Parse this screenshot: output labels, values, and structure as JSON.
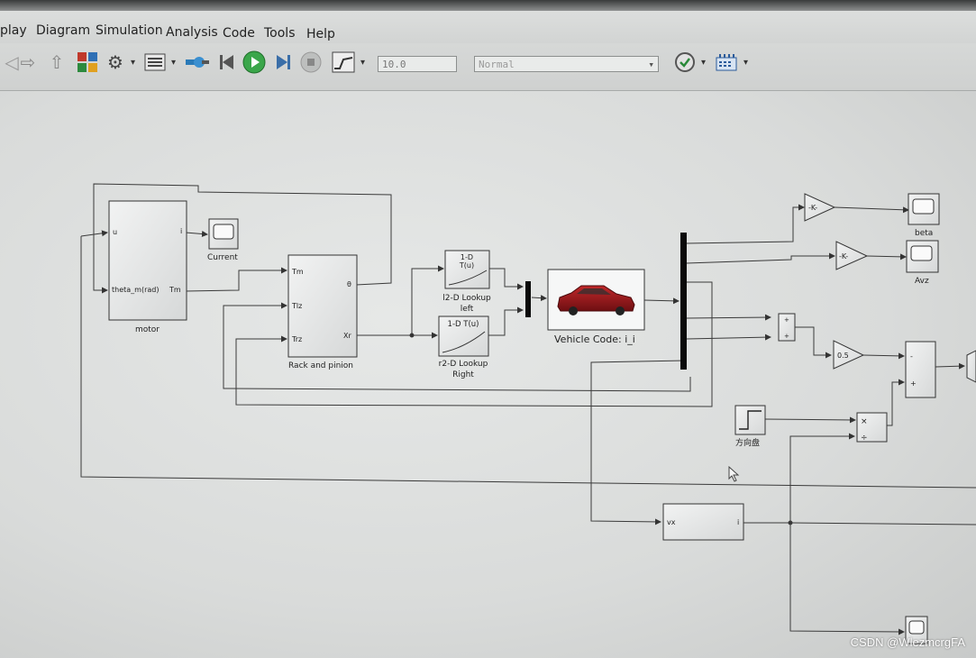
{
  "menu": {
    "items": [
      {
        "label": "play"
      },
      {
        "label": "Diagram"
      },
      {
        "label": "Simulation"
      },
      {
        "label": "Analysis"
      },
      {
        "label": "Code"
      },
      {
        "label": "Tools"
      },
      {
        "label": "Help"
      }
    ]
  },
  "toolbar": {
    "stop_time": "10.0",
    "mode": "Normal",
    "icons": [
      "forward-icon",
      "up-icon",
      "library-browser-icon",
      "settings-gear-icon",
      "model-explorer-icon",
      "connect-icon",
      "step-back-icon",
      "run-icon",
      "step-forward-icon",
      "stop-icon",
      "scope-icon",
      "check-icon",
      "build-icon"
    ]
  },
  "blocks": {
    "motor": {
      "in_u": "u",
      "in_theta": "theta_m(rad)",
      "out_i": "i",
      "out_tm": "Tm",
      "name": "motor"
    },
    "current_scope": {
      "name": "Current"
    },
    "rack": {
      "in_tm": "Tm",
      "in_tlz": "Tlz",
      "in_trz": "Trz",
      "out_theta": "θ",
      "out_xr": "Xr",
      "name": "Rack and pinion"
    },
    "lookup_left": {
      "header1": "1-D",
      "header2": "T(u)",
      "name1": "l2-D Lookup",
      "name2": "left"
    },
    "lookup_right": {
      "header": "1-D T(u)",
      "name1": "r2-D Lookup",
      "name2": "Right"
    },
    "vehicle": {
      "name": "Vehicle Code: i_i"
    },
    "gain1": {
      "label": "-K-"
    },
    "gain2": {
      "label": "-K-"
    },
    "gain3": {
      "label": "0.5"
    },
    "beta_scope": {
      "name": "beta"
    },
    "avz_scope": {
      "name": "Avz"
    },
    "step": {
      "name": "方向盘"
    },
    "product": {
      "sign1": "×",
      "sign2": "÷"
    },
    "vx_block": {
      "in": "vx",
      "out": "i"
    }
  },
  "watermark": "CSDN @WlezmcrgFA"
}
